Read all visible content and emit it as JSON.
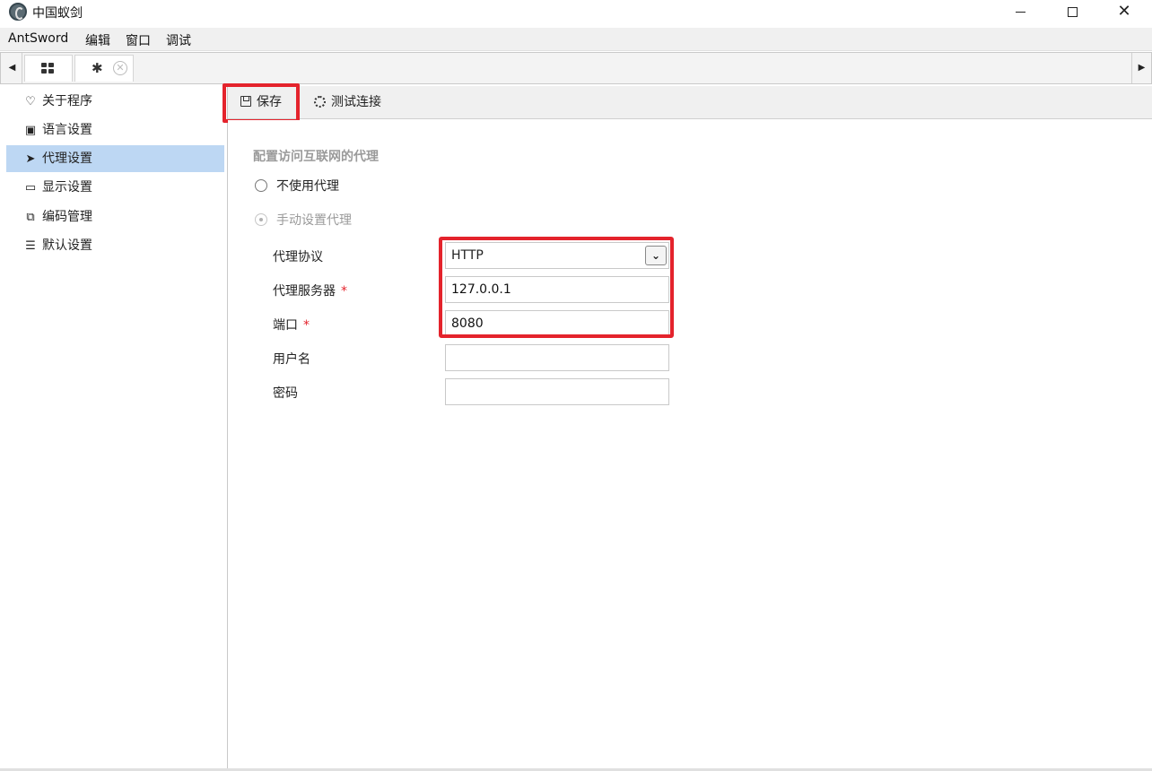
{
  "window": {
    "title": "中国蚁剑",
    "minimize_icon": "minimize-icon",
    "maximize_icon": "maximize-icon",
    "close_icon": "close-icon"
  },
  "menu": {
    "items": [
      {
        "label": "AntSword"
      },
      {
        "label": "编辑"
      },
      {
        "label": "窗口"
      },
      {
        "label": "调试"
      }
    ]
  },
  "tabs": {
    "items": [
      {
        "icon": "grid-icon",
        "active": false
      },
      {
        "icon": "gear-icon",
        "active": true,
        "close_icon": "close-circle-icon"
      }
    ]
  },
  "sidebar": {
    "items": [
      {
        "label": "关于程序",
        "icon": "heart-icon",
        "active": false
      },
      {
        "label": "语言设置",
        "icon": "language-icon",
        "active": false
      },
      {
        "label": "代理设置",
        "icon": "paper-plane-icon",
        "active": true
      },
      {
        "label": "显示设置",
        "icon": "monitor-icon",
        "active": false
      },
      {
        "label": "编码管理",
        "icon": "code-file-icon",
        "active": false
      },
      {
        "label": "默认设置",
        "icon": "sliders-icon",
        "active": false
      }
    ]
  },
  "toolbar": {
    "save_label": "保存",
    "test_label": "测试连接"
  },
  "form": {
    "section_title": "配置访问互联网的代理",
    "options": [
      {
        "label": "不使用代理",
        "selected": false
      },
      {
        "label": "手动设置代理",
        "selected": true
      }
    ],
    "protocol": {
      "label": "代理协议",
      "value": "HTTP"
    },
    "server": {
      "label": "代理服务器",
      "value": "127.0.0.1",
      "required_mark": "*"
    },
    "port": {
      "label": "端口",
      "value": "8080",
      "required_mark": "*"
    },
    "username": {
      "label": "用户名",
      "value": ""
    },
    "password": {
      "label": "密码",
      "value": ""
    }
  },
  "colors": {
    "highlight": "#e4232c",
    "active_sidebar": "#bdd7f3"
  }
}
